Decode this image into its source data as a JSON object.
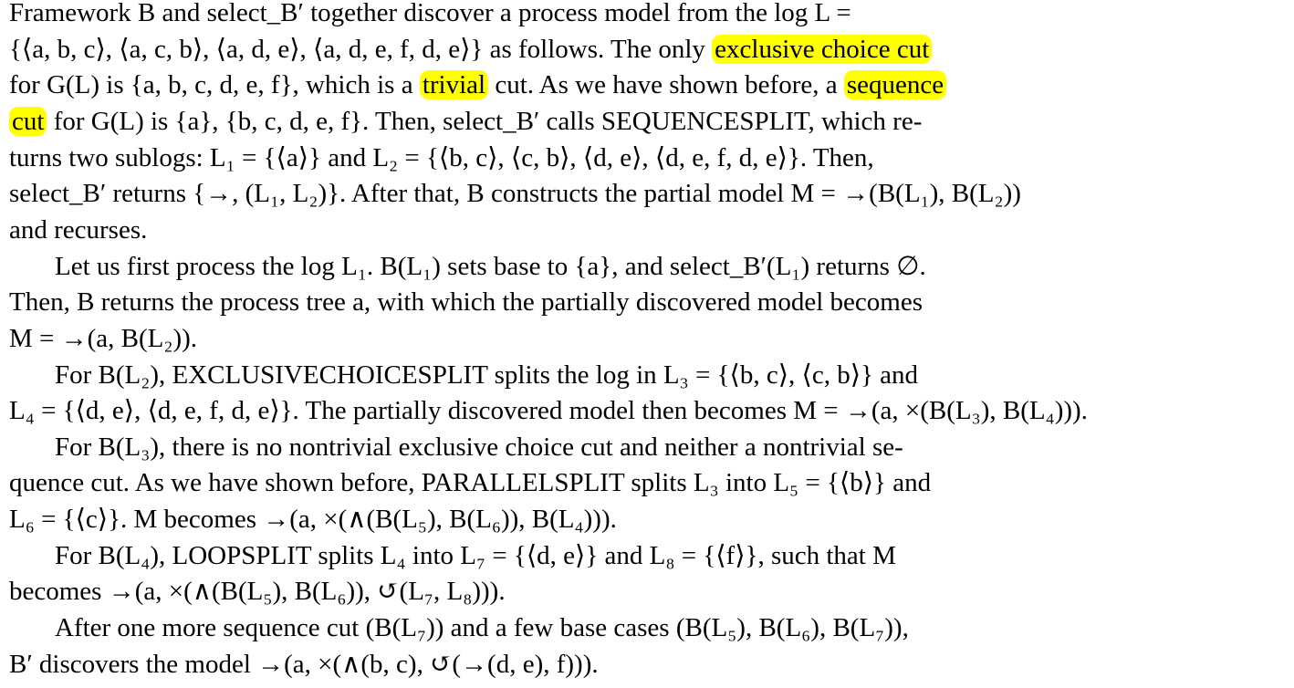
{
  "paper": {
    "highlight_color": "#ffff00",
    "lines": [
      {
        "segments": [
          {
            "text": "Framework B and select_B′ together discover a process model from the log L ="
          }
        ]
      },
      {
        "segments": [
          {
            "text": "{⟨a, b, c⟩, ⟨a, c, b⟩, ⟨a, d, e⟩, ⟨a, d, e, f, d, e⟩} as follows. The only "
          },
          {
            "text": "exclusive choice cut",
            "highlight": true
          }
        ]
      },
      {
        "segments": [
          {
            "text": "for G(L) is {a, b, c, d, e, f}, which is a "
          },
          {
            "text": "trivial",
            "highlight": true
          },
          {
            "text": " cut. As we have shown before, a "
          },
          {
            "text": "sequence",
            "highlight": true
          }
        ]
      },
      {
        "segments": [
          {
            "text": "cut",
            "highlight": true
          },
          {
            "text": " for G(L) is {a}, {b, c, d, e, f}. Then, select_B′ calls SEQUENCESPLIT, which re-"
          }
        ]
      },
      {
        "segments": [
          {
            "text": "turns two sublogs: L₁ = {⟨a⟩} and L₂ = {⟨b, c⟩, ⟨c, b⟩, ⟨d, e⟩, ⟨d, e, f, d, e⟩}. Then,"
          }
        ]
      },
      {
        "segments": [
          {
            "text": "select_B′ returns {→, (L₁, L₂)}. After that, B constructs the partial model M = →(B(L₁), B(L₂))"
          }
        ]
      },
      {
        "segments": [
          {
            "text": "and recurses."
          }
        ]
      },
      {
        "indent": true,
        "segments": [
          {
            "text": "Let us first process the log L₁. B(L₁) sets base to {a}, and select_B′(L₁) returns ∅."
          }
        ]
      },
      {
        "segments": [
          {
            "text": "Then, B returns the process tree a, with which the partially discovered model becomes"
          }
        ]
      },
      {
        "segments": [
          {
            "text": "M = →(a, B(L₂))."
          }
        ]
      },
      {
        "indent": true,
        "segments": [
          {
            "text": "For B(L₂), EXCLUSIVECHOICESPLIT splits the log in L₃ = {⟨b, c⟩, ⟨c, b⟩} and"
          }
        ]
      },
      {
        "segments": [
          {
            "text": "L₄ = {⟨d, e⟩, ⟨d, e, f, d, e⟩}. The partially discovered model then becomes M = →(a, ×(B(L₃), B(L₄)))."
          }
        ]
      },
      {
        "indent": true,
        "segments": [
          {
            "text": "For B(L₃), there is no nontrivial exclusive choice cut and neither a nontrivial se-"
          }
        ]
      },
      {
        "segments": [
          {
            "text": "quence cut. As we have shown before, PARALLELSPLIT splits L₃ into L₅ = {⟨b⟩} and"
          }
        ]
      },
      {
        "segments": [
          {
            "text": "L₆ = {⟨c⟩}. M becomes →(a, ×(∧(B(L₅), B(L₆)), B(L₄)))."
          }
        ]
      },
      {
        "indent": true,
        "segments": [
          {
            "text": "For B(L₄), LOOPSPLIT splits L₄ into L₇ = {⟨d, e⟩} and L₈ = {⟨f⟩}, such that M"
          }
        ]
      },
      {
        "segments": [
          {
            "text": "becomes →(a, ×(∧(B(L₅), B(L₆)), ↺(L₇, L₈)))."
          }
        ]
      },
      {
        "indent": true,
        "segments": [
          {
            "text": "After one more sequence cut (B(L₇)) and a few base cases (B(L₅), B(L₆), B(L₇)),"
          }
        ]
      },
      {
        "segments": [
          {
            "text": "B′ discovers the model →(a, ×(∧(b, c), ↺(→(d, e), f)))."
          }
        ]
      }
    ]
  }
}
